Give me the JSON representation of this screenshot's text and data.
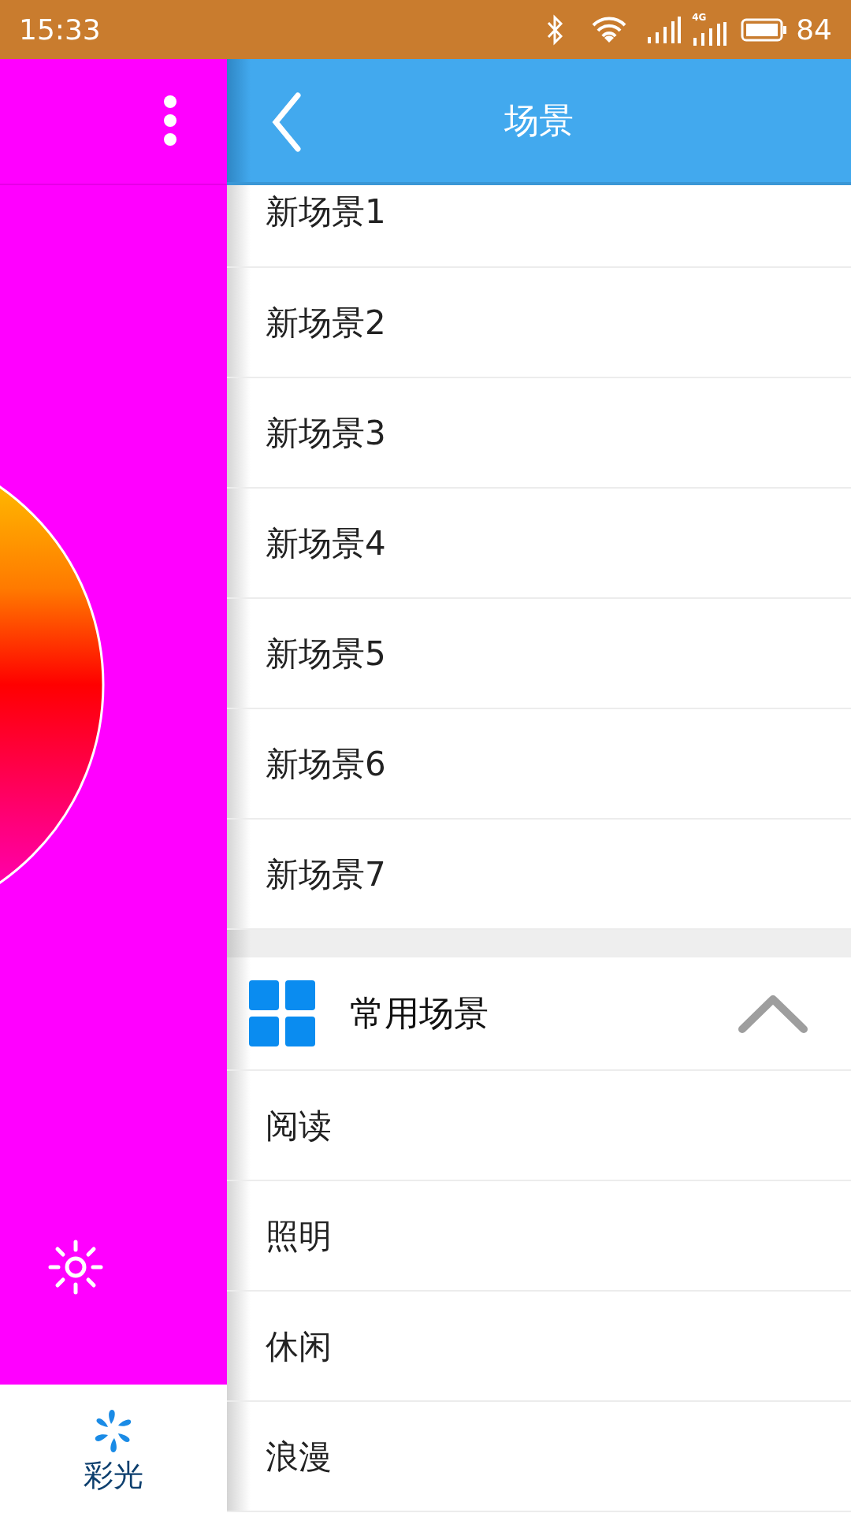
{
  "status_bar": {
    "time": "15:33",
    "network_type": "4G",
    "battery": "84"
  },
  "side_panel": {
    "tab": {
      "label": "彩光",
      "selected": true
    }
  },
  "header": {
    "title": "场景"
  },
  "scenes": [
    {
      "label": "新场景1"
    },
    {
      "label": "新场景2"
    },
    {
      "label": "新场景3"
    },
    {
      "label": "新场景4"
    },
    {
      "label": "新场景5"
    },
    {
      "label": "新场景6"
    },
    {
      "label": "新场景7"
    }
  ],
  "common_section": {
    "title": "常用场景",
    "expanded": true,
    "items": [
      {
        "label": "阅读"
      },
      {
        "label": "照明"
      },
      {
        "label": "休闲"
      },
      {
        "label": "浪漫"
      }
    ]
  }
}
